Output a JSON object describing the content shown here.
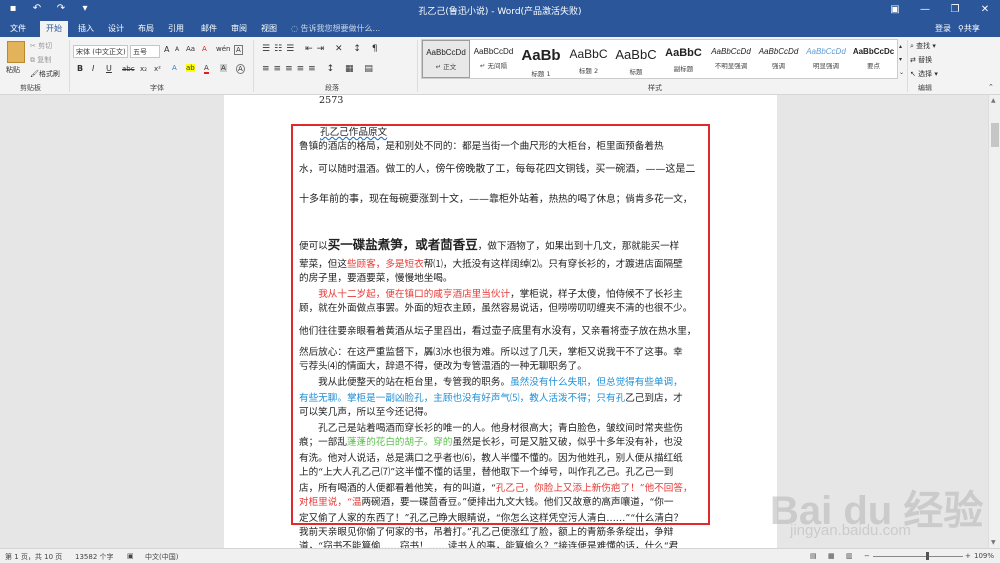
{
  "window": {
    "title": "孔乙己(鲁迅小说) - Word(产品激活失败)",
    "min": "—",
    "max": "❐",
    "close": "✕",
    "ribbon_toggle": "▣"
  },
  "qat": {
    "save": "▪",
    "undo": "↶",
    "redo": "↷",
    "customize": "▾"
  },
  "tabs": [
    "文件",
    "开始",
    "插入",
    "设计",
    "布局",
    "引用",
    "邮件",
    "审阅",
    "视图"
  ],
  "tell_me": "告诉我您想要做什么...",
  "signin": "登录",
  "share": "共享",
  "clipboard": {
    "paste": "粘贴",
    "cut": "剪切",
    "copy": "复制",
    "format_painter": "格式刷",
    "label": "剪贴板"
  },
  "font": {
    "name": "宋体 (中文正文)",
    "size": "五号",
    "label": "字体",
    "bold": "B",
    "italic": "I",
    "underline": "U",
    "strike": "abc",
    "sub": "x₂",
    "sup": "x²",
    "grow": "A",
    "shrink": "A",
    "clear": "A",
    "phonetic": "wén",
    "border": "A",
    "highlight": "ab",
    "color": "A",
    "case": "Aa",
    "enc": "A",
    "shade": "A"
  },
  "paragraph": {
    "label": "段落"
  },
  "styles": {
    "label": "样式",
    "items": [
      {
        "preview": "AaBbCcDd",
        "name": "正文",
        "size": "8px",
        "weight": "normal",
        "style": "normal"
      },
      {
        "preview": "AaBbCcDd",
        "name": "无间隔",
        "size": "8px",
        "weight": "normal",
        "style": "normal"
      },
      {
        "preview": "AaBb",
        "name": "标题 1",
        "size": "15px",
        "weight": "bold",
        "style": "normal"
      },
      {
        "preview": "AaBbC",
        "name": "标题 2",
        "size": "12px",
        "weight": "normal",
        "style": "normal"
      },
      {
        "preview": "AaBbC",
        "name": "标题",
        "size": "13px",
        "weight": "normal",
        "style": "normal"
      },
      {
        "preview": "AaBbC",
        "name": "副标题",
        "size": "11px",
        "weight": "bold",
        "style": "normal"
      },
      {
        "preview": "AaBbCcDd",
        "name": "不明显强调",
        "size": "8px",
        "weight": "normal",
        "style": "italic"
      },
      {
        "preview": "AaBbCcDd",
        "name": "强调",
        "size": "8px",
        "weight": "normal",
        "style": "italic"
      },
      {
        "preview": "AaBbCcDd",
        "name": "明显强调",
        "size": "8px",
        "weight": "normal",
        "style": "italic"
      },
      {
        "preview": "AaBbCcDc",
        "name": "要点",
        "size": "8px",
        "weight": "bold",
        "style": "normal"
      }
    ]
  },
  "editing": {
    "find": "查找",
    "replace": "替换",
    "select": "选择",
    "label": "编辑"
  },
  "doc": {
    "page_num": "2573",
    "title": "孔乙己作品原文",
    "lines": [
      [
        {
          "t": "鲁镇的酒店的格局，是和别处不同的：都是当街一个曲尺形的大柜台，柜里面预备着热"
        }
      ],
      [
        {
          "t": "水，可以随时温酒。"
        },
        {
          "t": "做工的人，傍午傍晚散了工，每每花四文铜钱，买一碗酒，——这是二",
          "s": "sans"
        }
      ],
      [
        {
          "t": "十多年前的事，现在每碗要涨到十文，——靠柜外站着",
          "s": "sans"
        },
        {
          "t": "，热热的喝了休息；倘肯多花一文，"
        }
      ],
      [
        {
          "t": "便可以"
        },
        {
          "t": "买一碟盐煮笋，或者茴香豆",
          "s": "big"
        },
        {
          "t": "，做下酒物了，如果出到十几文，那就能买一样"
        }
      ],
      [
        {
          "t": "荤菜，但这"
        },
        {
          "t": "些顾客，多是短衣",
          "c": "red"
        },
        {
          "t": "帮⑴，大抵没有这样阔绰⑵。只有穿长衫的，才踱进店面隔壁"
        }
      ],
      [
        {
          "t": "的房子里，要酒要菜，慢慢地坐喝。"
        }
      ],
      [
        {
          "t": "　　"
        },
        {
          "t": "我从十二岁起，便在镇口的咸亨酒店里当伙计",
          "c": "red"
        },
        {
          "t": "，掌柜说，样子太傻，怕侍候不了长衫主"
        }
      ],
      [
        {
          "t": "顾，就在外面做点事罢。外面的短衣主顾，虽然容易说话，但唠唠叨叨缠夹不清的也很不少。"
        }
      ],
      [
        {
          "t": "他们往往要亲眼看着黄酒从坛子里舀出，"
        },
        {
          "t": "看过壶子底里有水没有",
          "s": "sans"
        },
        {
          "t": "，又亲看将壶子放在热水里，"
        }
      ],
      [
        {
          "t": "然后放心：在这严重监督下，羼⑶水也很为难。所以过了几天，掌柜又说我干不了这事。幸"
        }
      ],
      [
        {
          "t": "亏荐头⑷的情面大，辞退不得，便改为专管温酒的一种无聊职务了。"
        }
      ],
      [
        {
          "t": "　　我从此便整天的站在柜台里，专管我的职务。"
        },
        {
          "t": "虽然没有什么失职，但总觉得有些单调，",
          "c": "blue"
        }
      ],
      [
        {
          "t": "有些无聊。掌柜是一副凶脸孔，主顾也没有好声气⑸，教人活泼不得；只有孔",
          "c": "blue"
        },
        {
          "t": "乙己到店，才"
        }
      ],
      [
        {
          "t": "可以笑几声，所以至今还记得。"
        }
      ],
      [
        {
          "t": "　　孔乙己是站着喝酒而穿长衫的唯一的人。他身材很高大；青白脸色，皱纹间时常夹些伤"
        }
      ],
      [
        {
          "t": "痕；一部乱"
        },
        {
          "t": "蓬蓬的花白的胡子。穿的",
          "c": "green"
        },
        {
          "t": "虽然是长衫，可是又脏又破，似乎十多年没有补，也没"
        }
      ],
      [
        {
          "t": "有洗。他对人说话，总是满口之乎者也⑹，教人半懂不懂的。因为他姓孔，别人便从描红纸"
        }
      ],
      [
        {
          "t": "上的“上大人孔乙己⑺”这半懂不懂的话里，替他取下一个绰号，叫作孔乙己。孔乙己一到"
        }
      ],
      [
        {
          "t": "店，所有喝酒的人便都看着他笑，有的叫道，“"
        },
        {
          "t": "孔乙己，你脸上又添上新伤疤了！”他不回答，",
          "c": "red"
        }
      ],
      [
        {
          "t": "对柜里说，“温",
          "c": "red"
        },
        {
          "t": "两碗酒，要一碟茴香豆。”便排出九文大钱。他们又故意的高声嚷道，“你一"
        }
      ],
      [
        {
          "t": "定又偷了人家的东西了！”孔乙己睁大眼睛说，“你怎么这样凭空污人清白……”“什么清白？"
        }
      ],
      [
        {
          "t": "我前天亲眼见你偷了何家的书，吊着打。”孔乙己便涨红了脸，额上的青筋条条绽出，争辩"
        }
      ],
      [
        {
          "t": "道，“窃书不能算偷……窃书！……读书人的事，能算偷么？”接连便是难懂的话，什么“君"
        }
      ]
    ]
  },
  "status": {
    "page": "第 1 页，共 10 页",
    "words": "13582 个字",
    "lang": "中文(中国)",
    "zoom": "109%"
  },
  "watermark": {
    "logo": "Bai du 经验",
    "url": "jingyan.baidu.com"
  }
}
